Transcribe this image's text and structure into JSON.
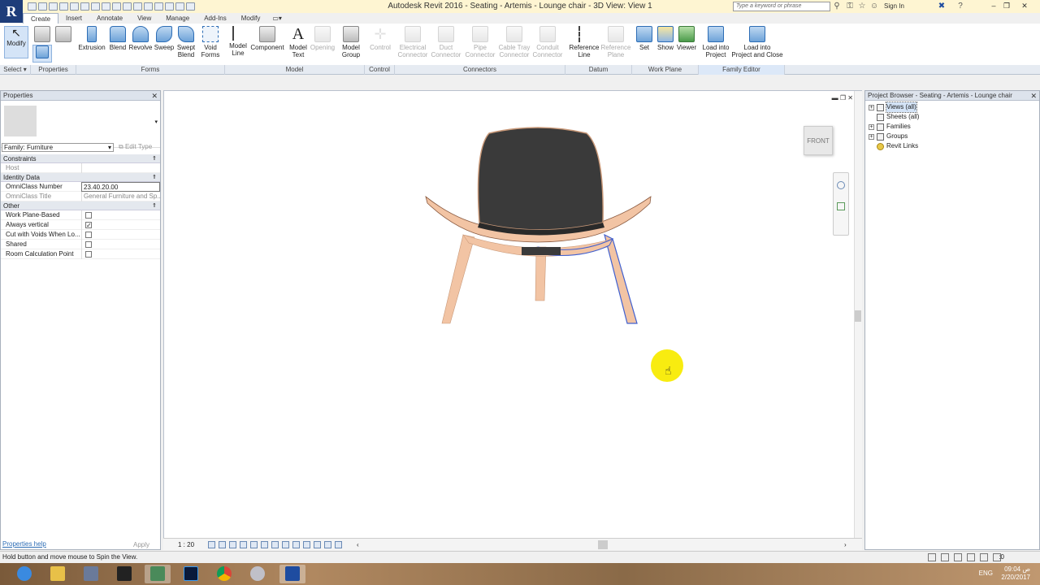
{
  "title_bar": {
    "app_title": "Autodesk Revit 2016 -     Seating - Artemis - Lounge chair - 3D View: View 1",
    "search_placeholder": "Type a keyword or phrase",
    "sign_in": "Sign In",
    "logo_letter": "R"
  },
  "ribbon": {
    "tabs": [
      "Create",
      "Insert",
      "Annotate",
      "View",
      "Manage",
      "Add-Ins",
      "Modify"
    ],
    "buttons": {
      "modify": "Modify",
      "extrusion": "Extrusion",
      "blend": "Blend",
      "revolve": "Revolve",
      "sweep": "Sweep",
      "swept_blend_1": "Swept",
      "swept_blend_2": "Blend",
      "void_forms_1": "Void",
      "void_forms_2": "Forms",
      "model_line_1": "Model",
      "model_line_2": "Line",
      "component": "Component",
      "model_text_1": "Model",
      "model_text_2": "Text",
      "opening": "Opening",
      "model_group_1": "Model",
      "model_group_2": "Group",
      "control": "Control",
      "electrical_connector_1": "Electrical",
      "electrical_connector_2": "Connector",
      "duct_connector_1": "Duct",
      "duct_connector_2": "Connector",
      "pipe_connector_1": "Pipe",
      "pipe_connector_2": "Connector",
      "cable_tray_connector_1": "Cable Tray",
      "cable_tray_connector_2": "Connector",
      "conduit_connector_1": "Conduit",
      "conduit_connector_2": "Connector",
      "reference_line_1": "Reference",
      "reference_line_2": "Line",
      "reference_plane_1": "Reference",
      "reference_plane_2": "Plane",
      "set": "Set",
      "show": "Show",
      "viewer": "Viewer",
      "load_into_project_1": "Load into",
      "load_into_project_2": "Project",
      "load_into_project_close_1": "Load into",
      "load_into_project_close_2": "Project and Close"
    },
    "panels": {
      "select": "Select ▾",
      "properties": "Properties",
      "forms": "Forms",
      "model": "Model",
      "control": "Control",
      "connectors": "Connectors",
      "datum": "Datum",
      "work_plane": "Work Plane",
      "family_editor": "Family Editor"
    }
  },
  "properties": {
    "header": "Properties",
    "family_select": "Family: Furniture",
    "edit_type": "Edit Type",
    "groups": {
      "constraints": "Constraints",
      "identity_data": "Identity Data",
      "other": "Other"
    },
    "rows": {
      "host": {
        "name": "Host",
        "value": ""
      },
      "omniclass_number": {
        "name": "OmniClass Number",
        "value": "23.40.20.00"
      },
      "omniclass_title": {
        "name": "OmniClass Title",
        "value": "General Furniture and Sp..."
      },
      "work_plane_based": {
        "name": "Work Plane-Based",
        "checked": false
      },
      "always_vertical": {
        "name": "Always vertical",
        "checked": true
      },
      "cut_with_voids": {
        "name": "Cut with Voids When Lo...",
        "checked": false
      },
      "shared": {
        "name": "Shared",
        "checked": false
      },
      "room_calc_point": {
        "name": "Room Calculation Point",
        "checked": false
      }
    },
    "help_link": "Properties help",
    "apply": "Apply"
  },
  "viewport": {
    "viewcube_face": "FRONT",
    "scale": "1 : 20"
  },
  "project_browser": {
    "header": "Project Browser - Seating - Artemis - Lounge chair",
    "items": [
      "Views (all)",
      "Sheets (all)",
      "Families",
      "Groups",
      "Revit Links"
    ]
  },
  "status_bar": {
    "message": "Hold button and move mouse to Spin the View.",
    "filter_count": ":0"
  },
  "taskbar": {
    "lang": "ENG",
    "time": "09:04 ص",
    "date": "2/20/2017"
  },
  "colors": {
    "title_bar_bg": "#fef5d2",
    "chair_shell": "#f2c4a4",
    "chair_seat": "#3a3a3a",
    "selection_blue": "#4060d0",
    "cursor_highlight": "#f8ec10"
  }
}
